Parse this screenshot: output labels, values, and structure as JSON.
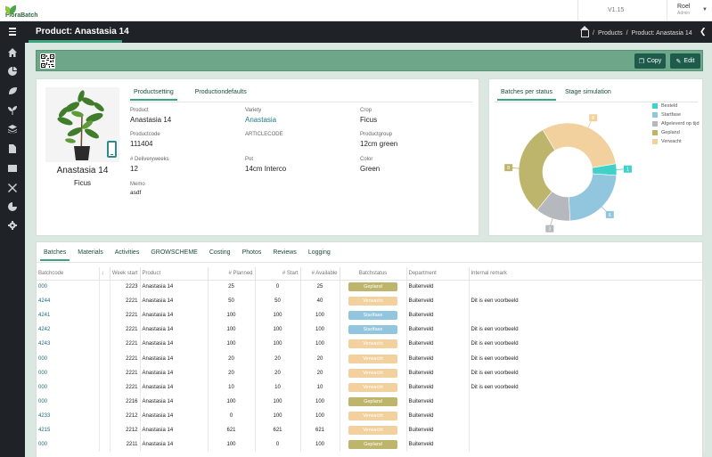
{
  "app": {
    "logo_text": "FloraBatch",
    "version": "V1.15",
    "user_name": "Roel",
    "user_role": "Admin"
  },
  "header": {
    "title": "Product: Anastasia 14",
    "breadcrumbs": [
      "Products",
      "Product: Anastasia 14"
    ]
  },
  "toolbar": {
    "copy_label": "Copy",
    "edit_label": "Edit"
  },
  "product": {
    "tabs": [
      "Productsetting",
      "Productiondefaults"
    ],
    "name": "Anastasia 14",
    "crop_display": "Ficus",
    "fields": [
      {
        "label": "Product",
        "value": "Anastasia 14",
        "link": false
      },
      {
        "label": "Variety",
        "value": "Anastasia",
        "link": true
      },
      {
        "label": "Crop",
        "value": "Ficus",
        "link": false
      },
      {
        "label": "Productcode",
        "value": "111404",
        "link": false
      },
      {
        "label": "ARTICLECODE",
        "value": "",
        "link": false
      },
      {
        "label": "Productgroup",
        "value": "12cm green",
        "link": false
      },
      {
        "label": "# Deliveryweeks",
        "value": "12",
        "link": false
      },
      {
        "label": "Pot",
        "value": "14cm Interco",
        "link": false
      },
      {
        "label": "Color",
        "value": "Green",
        "link": false
      },
      {
        "label": "Memo",
        "value": "asdf",
        "link": false
      }
    ]
  },
  "status_panel": {
    "tabs": [
      "Batches per status",
      "Stage simulation"
    ]
  },
  "chart_data": {
    "type": "pie",
    "categories": [
      "Besteld",
      "Startfase",
      "Afgeleverd op tijd",
      "Gepland",
      "Verwacht"
    ],
    "values": [
      1,
      6,
      3,
      8,
      8
    ],
    "colors": [
      "#40d1c8",
      "#92c5de",
      "#b5b8bd",
      "#bdb56b",
      "#f2d19e"
    ]
  },
  "batches": {
    "tabs": [
      "Batches",
      "Materials",
      "Activities",
      "GROWSCHEME",
      "Costing",
      "Photos",
      "Reviews",
      "Logging"
    ],
    "columns": [
      "Batchcode",
      "↓",
      "Week start",
      "Product",
      "# Planned",
      "# Start",
      "# Available",
      "Batchstatus",
      "Department",
      "Internal remark"
    ],
    "rows": [
      {
        "code": "000",
        "week": "2223",
        "product": "Anastasia 14",
        "planned": "25",
        "start": "0",
        "available": "25",
        "status": "Gepland",
        "color": "#bdb56b",
        "dept": "Buitenveld",
        "remark": ""
      },
      {
        "code": "4244",
        "week": "2221",
        "product": "Anastasia 14",
        "planned": "50",
        "start": "50",
        "available": "40",
        "status": "Verwacht",
        "color": "#f2d19e",
        "dept": "Buitenveld",
        "remark": "Dit is een voorbeeld"
      },
      {
        "code": "4241",
        "week": "2221",
        "product": "Anastasia 14",
        "planned": "100",
        "start": "100",
        "available": "100",
        "status": "Startfase",
        "color": "#92c5de",
        "dept": "Buitenveld",
        "remark": ""
      },
      {
        "code": "4242",
        "week": "2221",
        "product": "Anastasia 14",
        "planned": "100",
        "start": "100",
        "available": "100",
        "status": "Startfase",
        "color": "#92c5de",
        "dept": "Buitenveld",
        "remark": "Dit is een voorbeeld"
      },
      {
        "code": "4243",
        "week": "2221",
        "product": "Anastasia 14",
        "planned": "100",
        "start": "100",
        "available": "100",
        "status": "Verwacht",
        "color": "#f2d19e",
        "dept": "Buitenveld",
        "remark": "Dit is een voorbeeld"
      },
      {
        "code": "000",
        "week": "2221",
        "product": "Anastasia 14",
        "planned": "20",
        "start": "20",
        "available": "20",
        "status": "Verwacht",
        "color": "#f2d19e",
        "dept": "Buitenveld",
        "remark": "Dit is een voorbeeld"
      },
      {
        "code": "000",
        "week": "2221",
        "product": "Anastasia 14",
        "planned": "20",
        "start": "20",
        "available": "20",
        "status": "Verwacht",
        "color": "#f2d19e",
        "dept": "Buitenveld",
        "remark": "Dit is een voorbeeld"
      },
      {
        "code": "000",
        "week": "2221",
        "product": "Anastasia 14",
        "planned": "10",
        "start": "10",
        "available": "10",
        "status": "Verwacht",
        "color": "#f2d19e",
        "dept": "Buitenveld",
        "remark": "Dit is een voorbeeld"
      },
      {
        "code": "000",
        "week": "2216",
        "product": "Anastasia 14",
        "planned": "100",
        "start": "100",
        "available": "100",
        "status": "Gepland",
        "color": "#bdb56b",
        "dept": "Buitenveld",
        "remark": ""
      },
      {
        "code": "4233",
        "week": "2212",
        "product": "Anastasia 14",
        "planned": "0",
        "start": "100",
        "available": "100",
        "status": "Verwacht",
        "color": "#f2d19e",
        "dept": "Buitenveld",
        "remark": ""
      },
      {
        "code": "4215",
        "week": "2212",
        "product": "Anastasia 14",
        "planned": "621",
        "start": "621",
        "available": "621",
        "status": "Verwacht",
        "color": "#f2d19e",
        "dept": "Buitenveld",
        "remark": ""
      },
      {
        "code": "000",
        "week": "2211",
        "product": "Anastasia 14",
        "planned": "100",
        "start": "0",
        "available": "100",
        "status": "Gepland",
        "color": "#bdb56b",
        "dept": "Buitenveld",
        "remark": ""
      }
    ]
  }
}
